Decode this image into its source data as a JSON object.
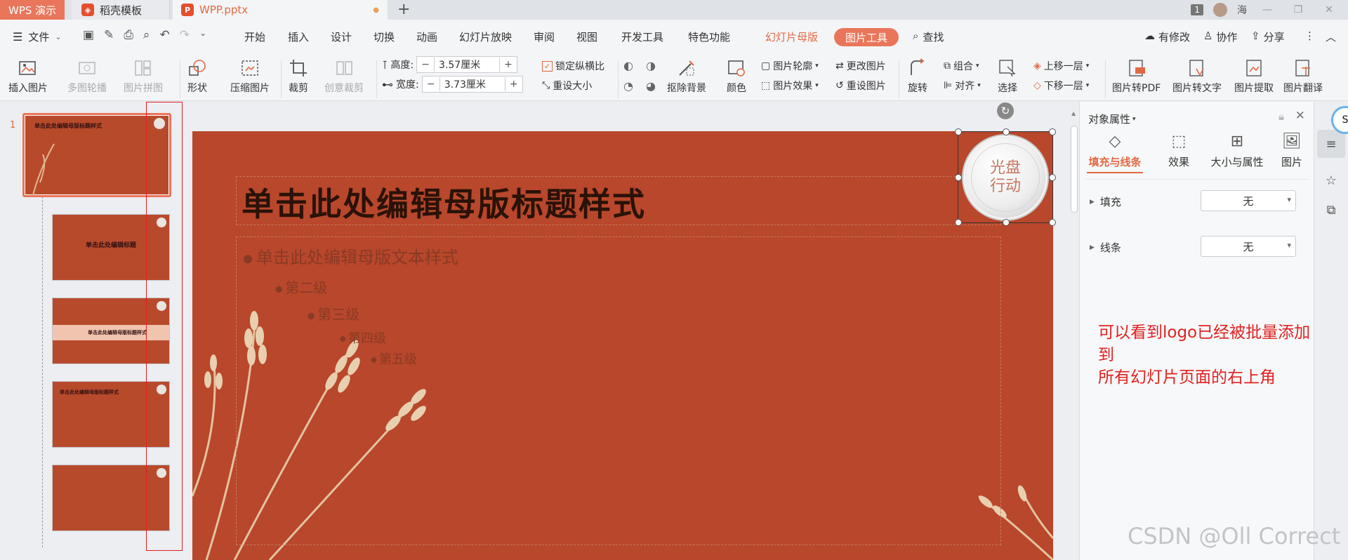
{
  "titlebar": {
    "app_tab": "WPS 演示",
    "template_tab": "稻壳模板",
    "file_tab": "WPP.pptx",
    "badge": "1",
    "user": "海"
  },
  "menu": {
    "file": "文件",
    "items": [
      "开始",
      "插入",
      "设计",
      "切换",
      "动画",
      "幻灯片放映",
      "审阅",
      "视图",
      "开发工具",
      "特色功能"
    ],
    "master": "幻灯片母版",
    "picture_tools": "图片工具",
    "search": "查找",
    "changes": "有修改",
    "collab": "协作",
    "share": "分享"
  },
  "ribbon": {
    "insert_picture": "插入图片",
    "multi_carousel": "多图轮播",
    "picture_collage": "图片拼图",
    "shape": "形状",
    "compress": "压缩图片",
    "crop": "裁剪",
    "creative_crop": "创意裁剪",
    "height_label": "高度:",
    "height_value": "3.57厘米",
    "width_label": "宽度:",
    "width_value": "3.73厘米",
    "lock_ratio": "锁定纵横比",
    "reset_size": "重设大小",
    "remove_bg": "抠除背景",
    "color": "颜色",
    "outline": "图片轮廓",
    "effects": "图片效果",
    "change_picture": "更改图片",
    "reset_picture": "重设图片",
    "rotate": "旋转",
    "group": "组合",
    "align": "对齐",
    "select": "选择",
    "bring_forward": "上移一层",
    "send_backward": "下移一层",
    "to_pdf": "图片转PDF",
    "to_text": "图片转文字",
    "extract": "图片提取",
    "translate": "图片翻译"
  },
  "thumbs": {
    "slide_number": "1",
    "t1_title": "单击此处编辑母版标题样式",
    "t2_title": "单击此处编辑标题",
    "t3_title": "单击此处编辑母版标题样式",
    "t4_title": "单击此处编辑母版标题样式"
  },
  "slide": {
    "title": "单击此处编辑母版标题样式",
    "level1": "单击此处编辑母版文本样式",
    "level2": "第二级",
    "level3": "第三级",
    "level4": "第四级",
    "level5": "第五级",
    "logo_line1": "光盘",
    "logo_line2": "行动"
  },
  "pane": {
    "title": "对象属性",
    "tabs": [
      "填充与线条",
      "效果",
      "大小与属性",
      "图片"
    ],
    "fill_label": "填充",
    "fill_value": "无",
    "line_label": "线条",
    "line_value": "无",
    "annotation": [
      "可以看到logo已经被批量添加到",
      "所有幻灯片页面的右上角"
    ]
  },
  "watermark": "CSDN @Oll Correct"
}
